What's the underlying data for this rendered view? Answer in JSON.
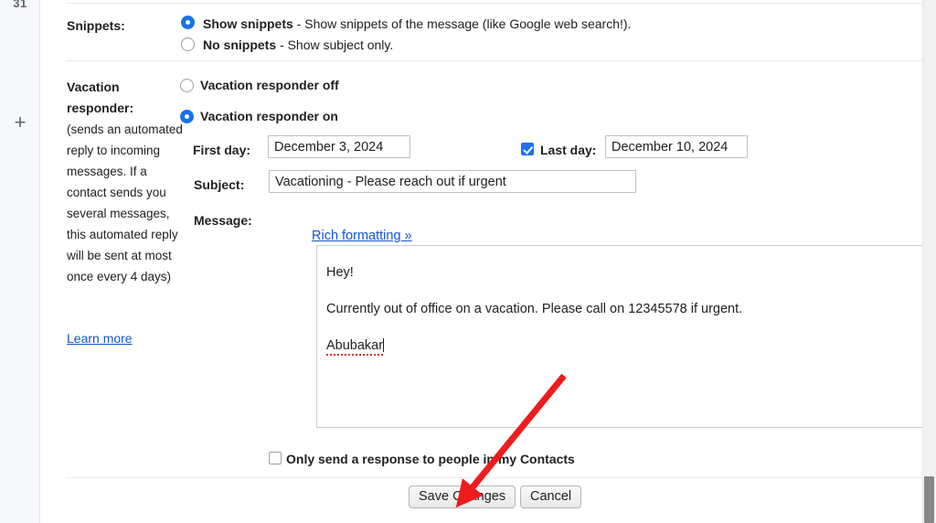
{
  "left_rail": {
    "calendar_icon_label": "31",
    "add_icon_label": "+"
  },
  "settings": {
    "snippets": {
      "label": "Snippets:",
      "options": [
        {
          "bold": "Show snippets",
          "desc": " - Show snippets of the message (like Google web search!).",
          "selected": true
        },
        {
          "bold": "No snippets",
          "desc": " - Show subject only.",
          "selected": false
        }
      ]
    },
    "vacation_responder": {
      "label": "Vacation responder:",
      "note": "(sends an automated reply to incoming messages. If a contact sends you several messages, this automated reply will be sent at most once every 4 days)",
      "learn_more": "Learn more",
      "options": [
        {
          "bold": "Vacation responder off",
          "selected": false
        },
        {
          "bold": "Vacation responder on",
          "selected": true
        }
      ],
      "first_day": {
        "label": "First day:",
        "value": "December 3, 2024"
      },
      "last_day": {
        "label": "Last day:",
        "value": "December 10, 2024",
        "checked": true
      },
      "subject": {
        "label": "Subject:",
        "value": "Vacationing - Please reach out if urgent"
      },
      "message": {
        "label": "Message:",
        "rich_formatting_link": "Rich formatting »",
        "lines": [
          "Hey!",
          "Currently out of office on a vacation. Please call on 12345578 if urgent.",
          "Abubakar"
        ],
        "misspelled_word": "Abubakar"
      },
      "contacts_only": {
        "label": "Only send a response to people in my Contacts",
        "checked": false
      }
    },
    "actions": {
      "save_label": "Save Changes",
      "cancel_label": "Cancel"
    }
  },
  "colors": {
    "accent": "#1a73e8",
    "link": "#1155cc",
    "annotation": "#ee1c1c",
    "text": "#202124",
    "rail_bg": "#f6f8fc"
  }
}
